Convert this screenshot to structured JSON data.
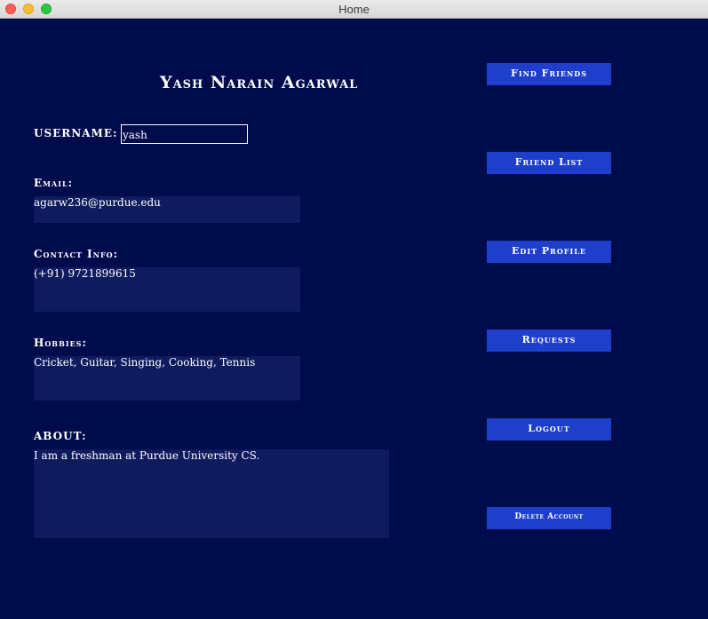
{
  "window": {
    "title": "Home"
  },
  "profile": {
    "name": "Yash Narain Agarwal",
    "username_label": "USERNAME:",
    "username_value": "yash",
    "email_label": "Email:",
    "email_value": "agarw236@purdue.edu",
    "contact_label": "Contact Info:",
    "contact_value": "(+91) 9721899615",
    "hobbies_label": "Hobbies:",
    "hobbies_value": "Cricket, Guitar, Singing, Cooking, Tennis",
    "about_label": "ABOUT:",
    "about_value": "I am a freshman at Purdue University CS."
  },
  "sidebar": {
    "buttons": [
      {
        "label": "Find Friends"
      },
      {
        "label": "Friend List"
      },
      {
        "label": "Edit Profile"
      },
      {
        "label": "Requests"
      },
      {
        "label": "Logout"
      },
      {
        "label": "Delete Account"
      }
    ]
  },
  "colors": {
    "background": "#000b4c",
    "field_background": "#0e1b5e",
    "button_background": "#1d3fcc",
    "text": "#ffffff"
  }
}
